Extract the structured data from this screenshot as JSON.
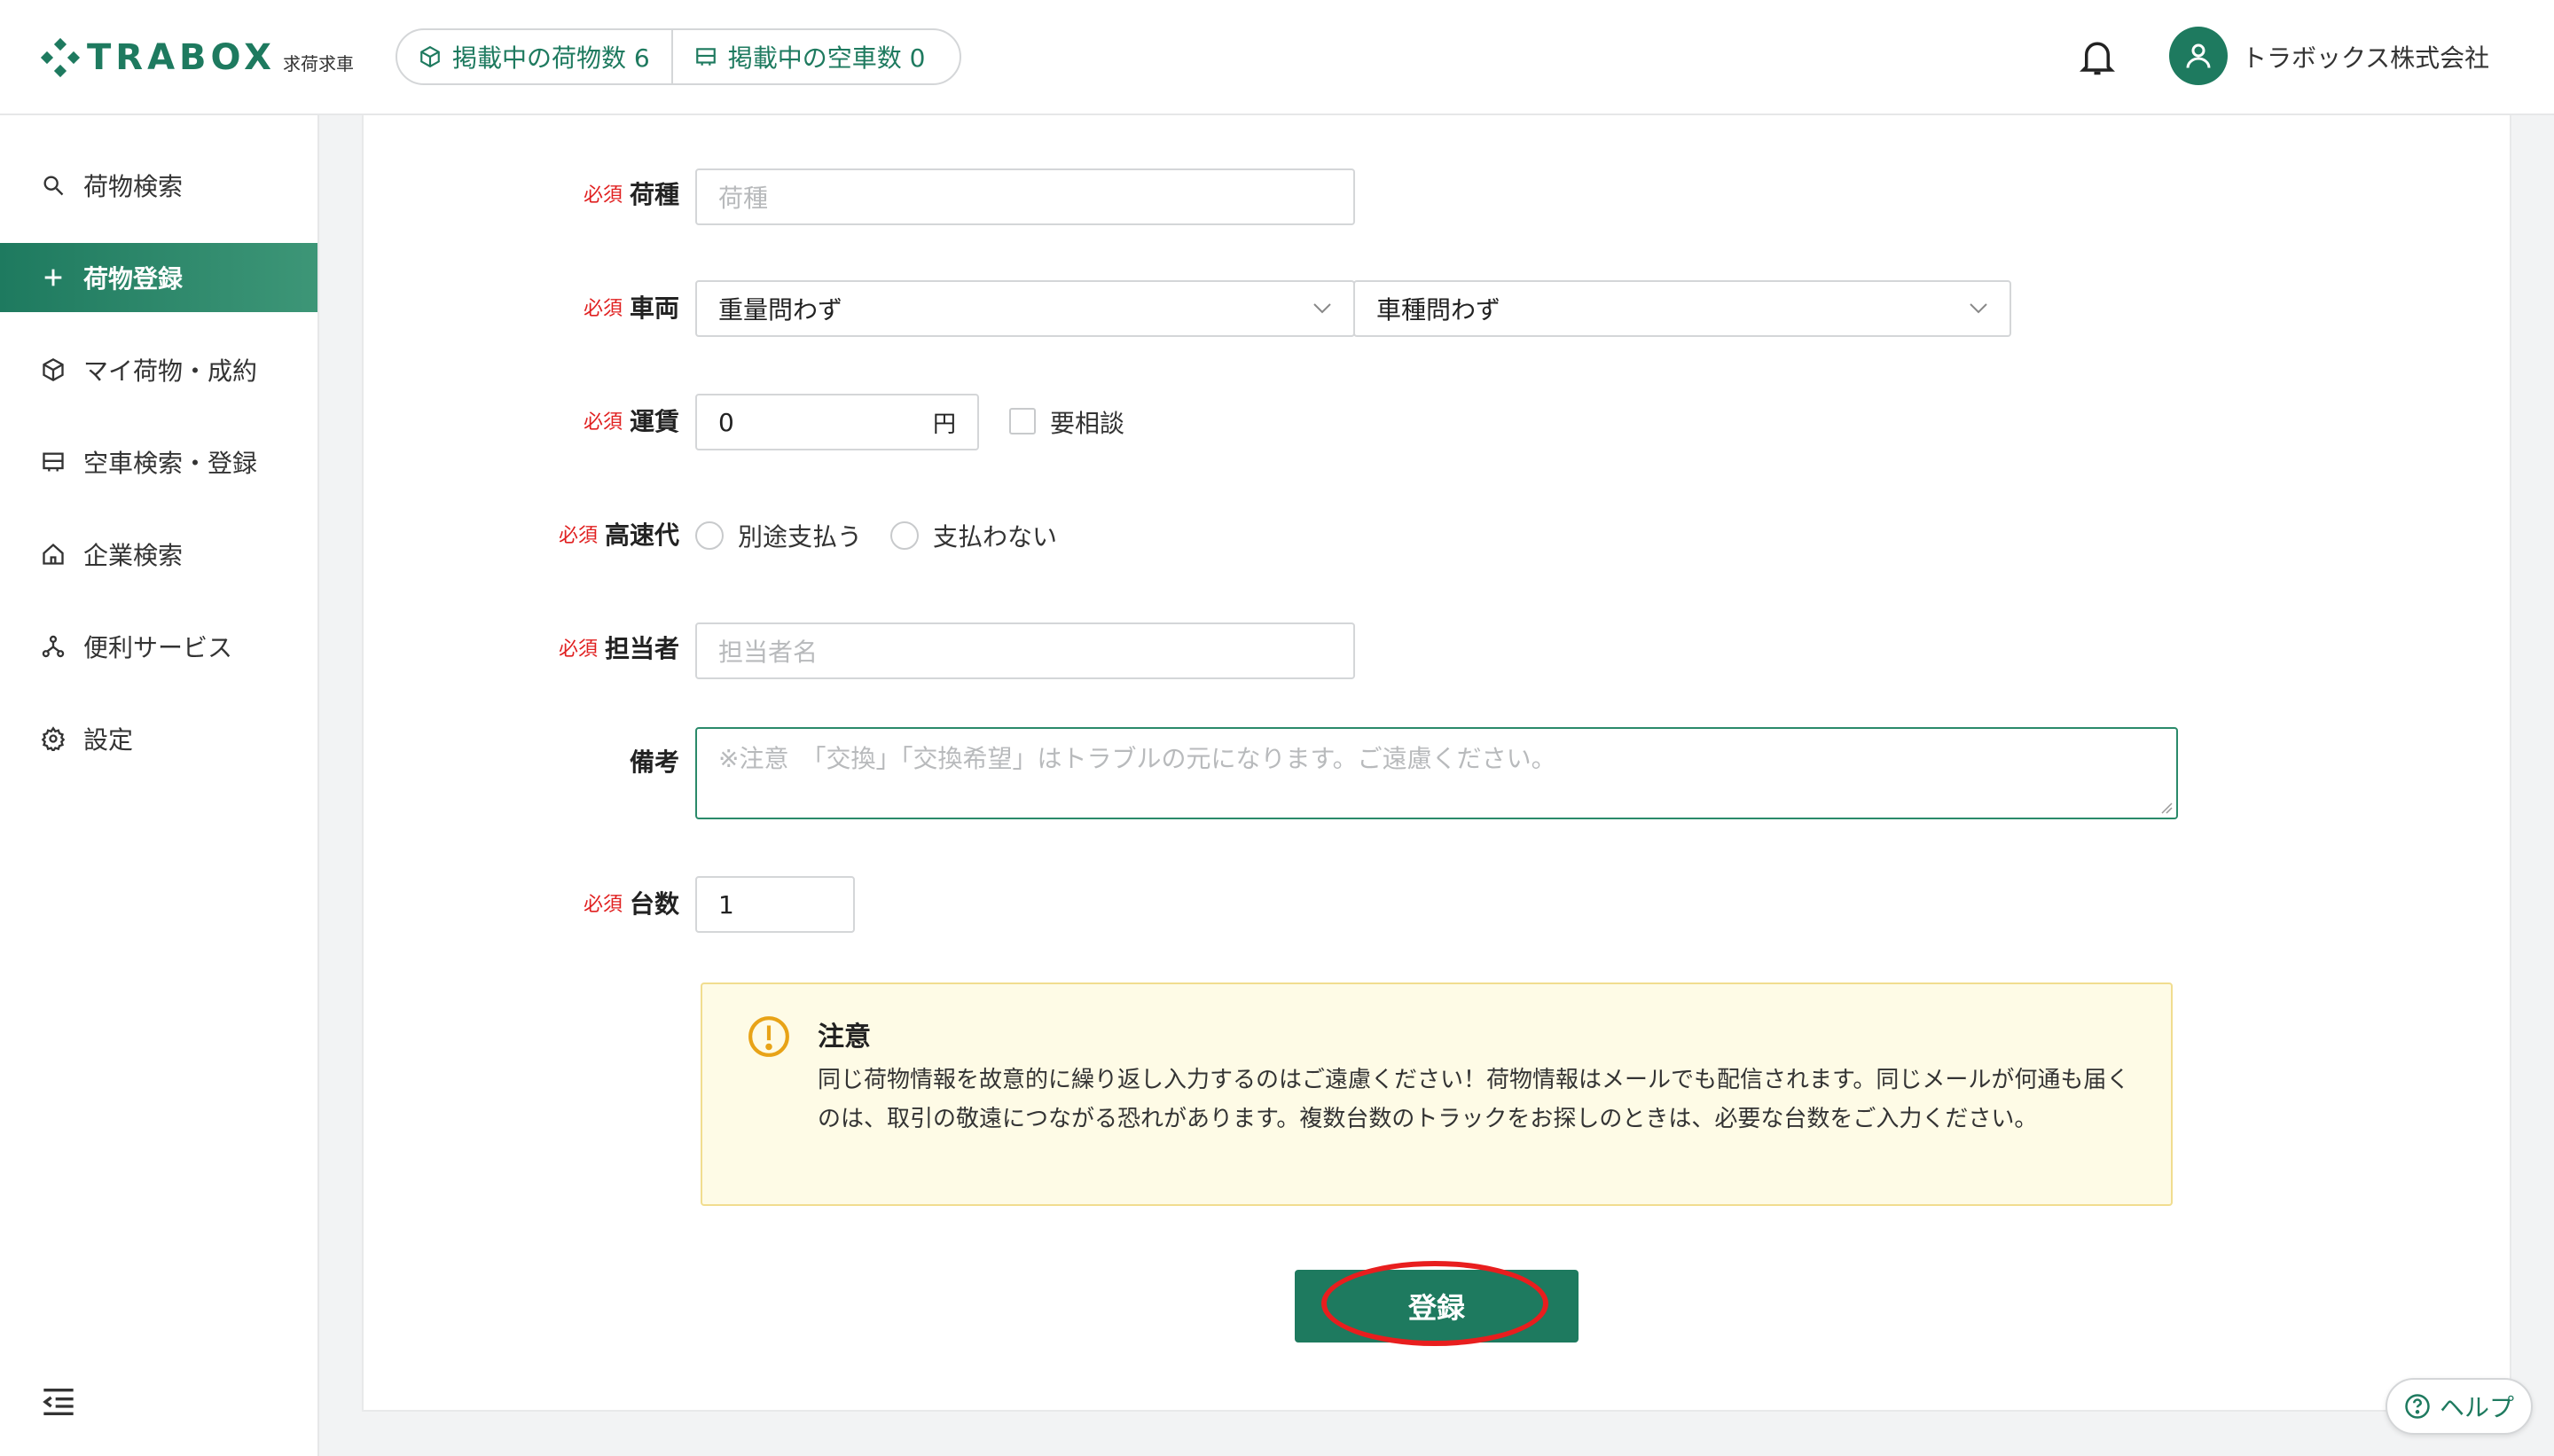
{
  "header": {
    "logo_text": "TRABOX",
    "logo_sub": "求荷求車",
    "stats": [
      {
        "label": "掲載中の荷物数 6"
      },
      {
        "label": "掲載中の空車数 0"
      }
    ],
    "company_name": "トラボックス株式会社"
  },
  "sidebar": {
    "items": [
      {
        "label": "荷物検索",
        "icon": "search-icon"
      },
      {
        "label": "荷物登録",
        "icon": "plus-icon",
        "active": true
      },
      {
        "label": "マイ荷物・成約",
        "icon": "box-icon"
      },
      {
        "label": "空車検索・登録",
        "icon": "truck-icon"
      },
      {
        "label": "企業検索",
        "icon": "home-icon"
      },
      {
        "label": "便利サービス",
        "icon": "network-icon"
      },
      {
        "label": "設定",
        "icon": "gear-icon"
      }
    ]
  },
  "form": {
    "required_label": "必須",
    "cargo_type": {
      "label": "荷種",
      "placeholder": "荷種"
    },
    "vehicle": {
      "label": "車両",
      "weight_value": "重量問わず",
      "type_value": "車種問わず"
    },
    "fare": {
      "label": "運賃",
      "value": "0",
      "unit": "円",
      "consult_label": "要相談"
    },
    "highway": {
      "label": "高速代",
      "option1": "別途支払う",
      "option2": "支払わない"
    },
    "contact": {
      "label": "担当者",
      "placeholder": "担当者名"
    },
    "remarks": {
      "label": "備考",
      "placeholder": "※注意　「交換」「交換希望」はトラブルの元になります。ご遠慮ください。"
    },
    "count": {
      "label": "台数",
      "value": "1"
    }
  },
  "notice": {
    "title": "注意",
    "body": "同じ荷物情報を故意的に繰り返し入力するのはご遠慮ください！荷物情報はメールでも配信されます。同じメールが何通も届くのは、取引の敬遠につながる恐れがあります。複数台数のトラックをお探しのときは、必要な台数をご入力ください。"
  },
  "submit_label": "登録",
  "help_label": "ヘルプ",
  "colors": {
    "brand": "#1e7a5f",
    "required": "#e02020",
    "notice_bg": "#fefbe6",
    "highlight": "#e81e1e"
  }
}
